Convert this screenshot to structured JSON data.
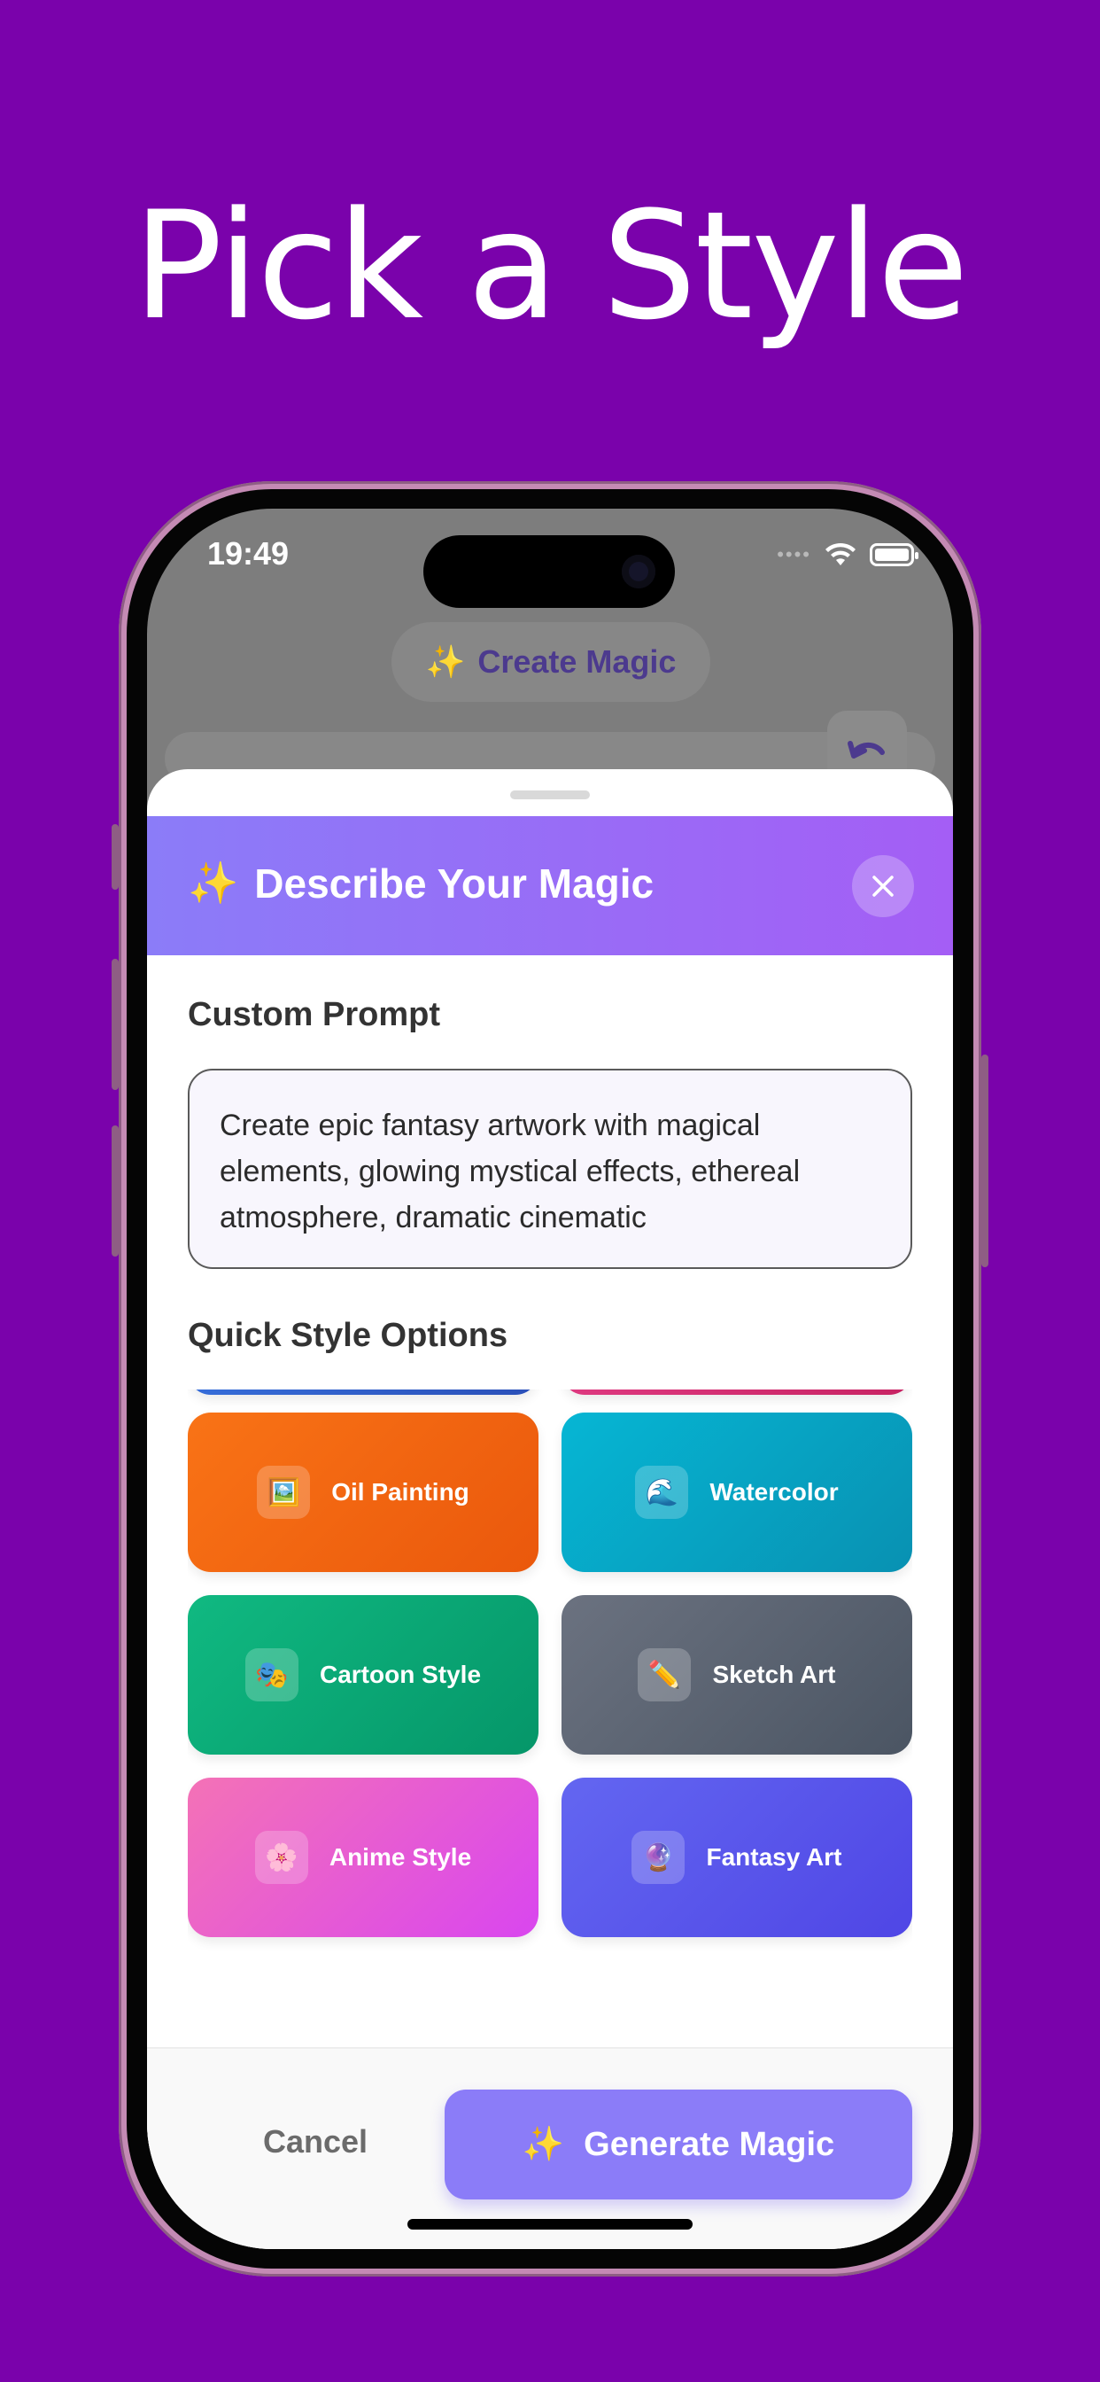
{
  "headline": "Pick a Style",
  "status_bar": {
    "time": "19:49",
    "signal": "••••"
  },
  "background_app": {
    "create_magic_label": "Create Magic",
    "sparkle": "✨"
  },
  "sheet": {
    "title": "Describe Your Magic",
    "title_icon": "✨",
    "custom_prompt_label": "Custom Prompt",
    "prompt_text": "Create epic fantasy artwork with magical elements, glowing mystical effects, ethereal atmosphere, dramatic cinematic",
    "quick_style_label": "Quick Style Options",
    "styles": [
      {
        "label": "",
        "icon": "",
        "gradient": [
          "#3b7be8",
          "#2a4fb8"
        ]
      },
      {
        "label": "",
        "icon": "",
        "gradient": [
          "#e9448e",
          "#c72262"
        ]
      },
      {
        "label": "Oil Painting",
        "icon": "🖼️",
        "gradient": [
          "#f97316",
          "#ea580c"
        ]
      },
      {
        "label": "Watercolor",
        "icon": "🌊",
        "gradient": [
          "#06b6d4",
          "#0891b2"
        ]
      },
      {
        "label": "Cartoon Style",
        "icon": "🎭",
        "gradient": [
          "#10b981",
          "#059669"
        ]
      },
      {
        "label": "Sketch Art",
        "icon": "✏️",
        "gradient": [
          "#6b7280",
          "#4b5563"
        ]
      },
      {
        "label": "Anime Style",
        "icon": "🌸",
        "gradient": [
          "#f472b6",
          "#d946ef"
        ]
      },
      {
        "label": "Fantasy Art",
        "icon": "🔮",
        "gradient": [
          "#6366f1",
          "#4f46e5"
        ]
      }
    ],
    "cancel_label": "Cancel",
    "generate_label": "Generate Magic",
    "generate_icon": "✨"
  },
  "colors": {
    "background": "#7a02ab",
    "header_gradient_start": "#8b7cf8",
    "header_gradient_end": "#a45ef5",
    "generate_button": "#8b7cf8"
  }
}
